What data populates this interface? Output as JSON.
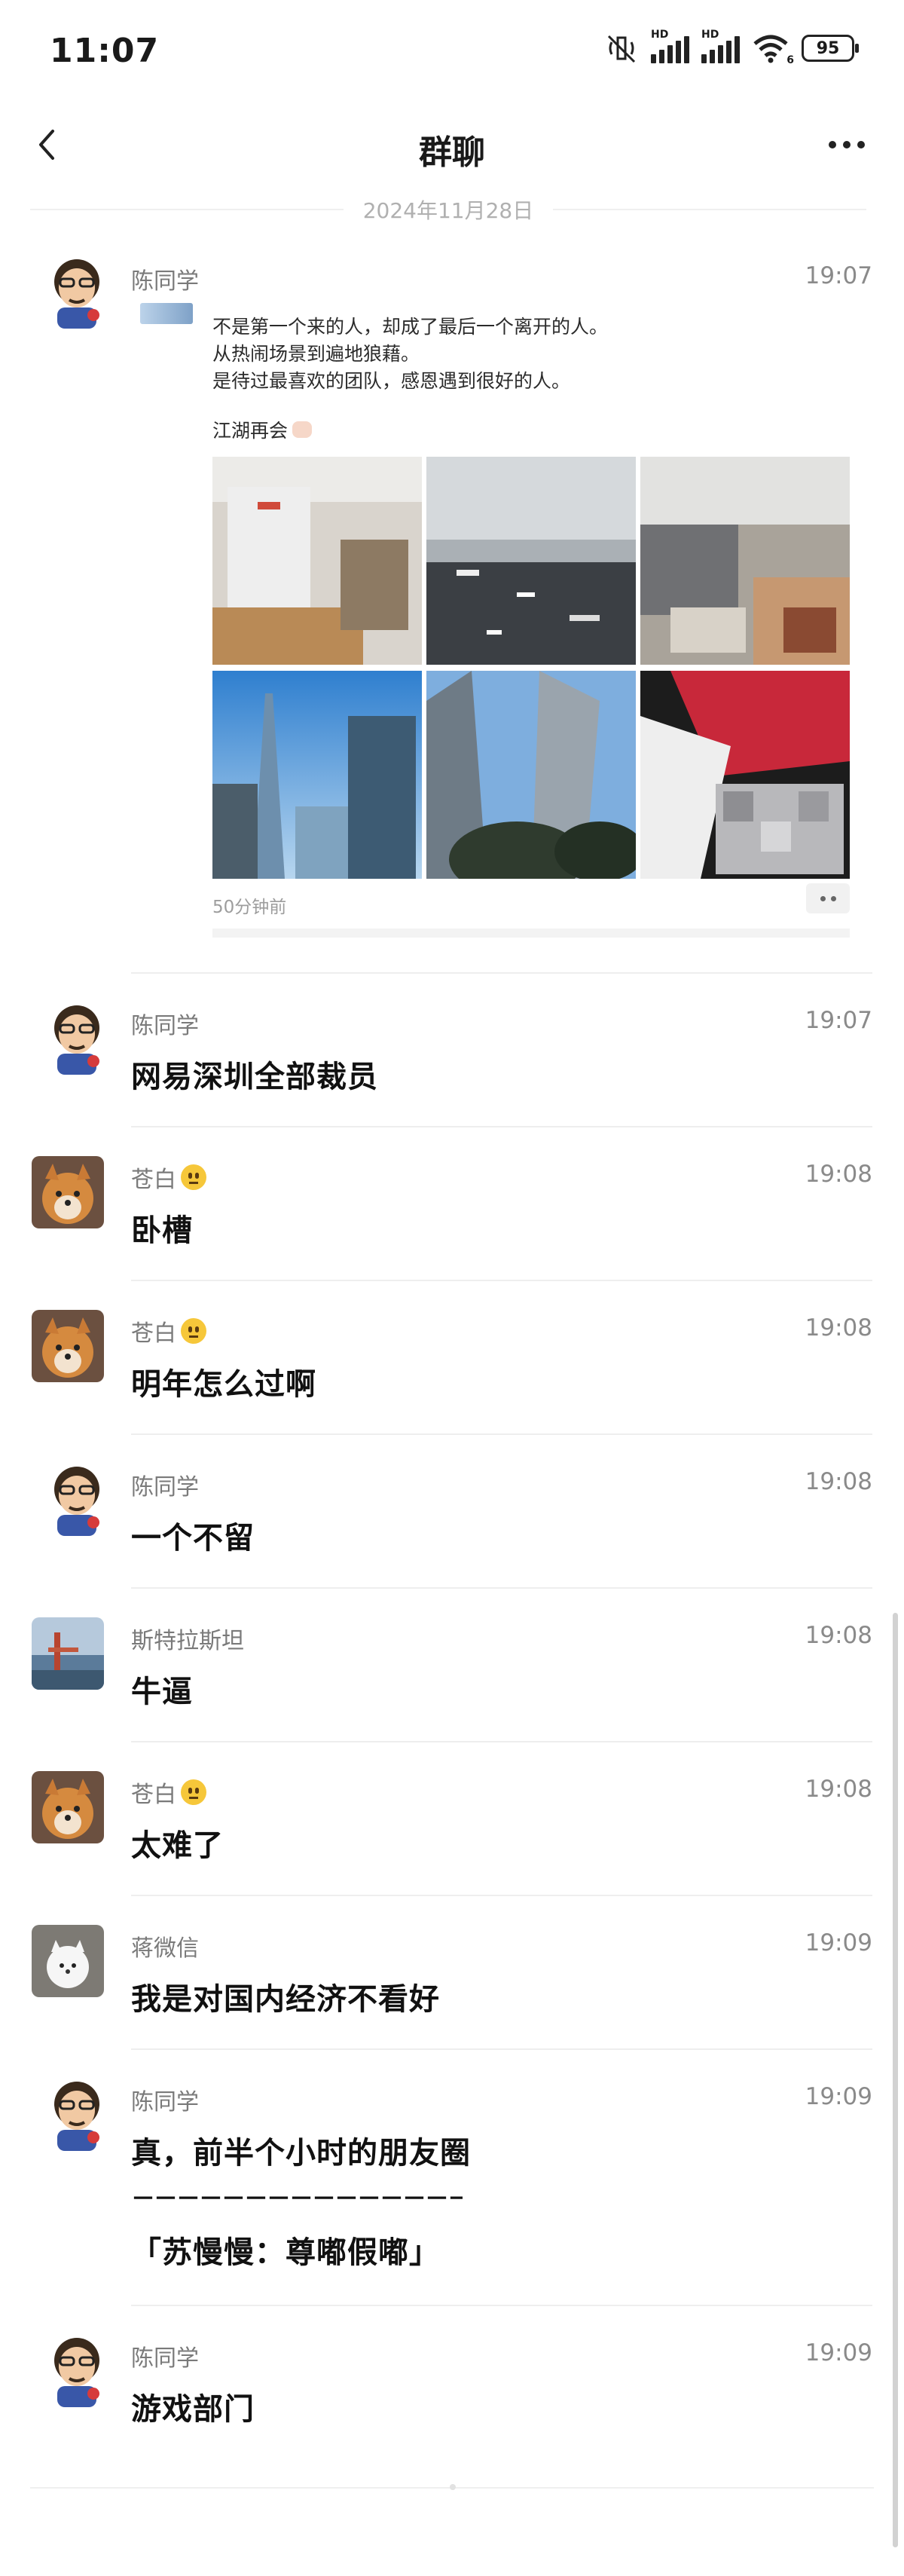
{
  "status_bar": {
    "time": "11:07",
    "signal_badges": [
      "HD",
      "HD"
    ],
    "wifi_badge": "6",
    "battery": "95"
  },
  "nav": {
    "title": "群聊"
  },
  "date_separator": "2024年11月28日",
  "messages": [
    {
      "sender": "陈同学",
      "time": "19:07",
      "type": "moments-card",
      "card": {
        "lines": [
          "不是第一个来的人，却成了最后一个离开的人。",
          "从热闹场景到遍地狼藉。",
          "是待过最喜欢的团队，感恩遇到很好的人。",
          "江湖再会"
        ],
        "time_ago": "50分钟前",
        "photos": [
          "empty-office-photo",
          "messy-office-floor-photo",
          "office-boxes-photo",
          "shenzhen-skyline-photo",
          "tower-building-photo",
          "red-black-blurred-photo"
        ]
      }
    },
    {
      "sender": "陈同学",
      "time": "19:07",
      "text": "网易深圳全部裁员"
    },
    {
      "sender": "苍白",
      "time": "19:08",
      "text": "卧槽"
    },
    {
      "sender": "苍白",
      "time": "19:08",
      "text": "明年怎么过啊"
    },
    {
      "sender": "陈同学",
      "time": "19:08",
      "text": "一个不留"
    },
    {
      "sender": "斯特拉斯坦",
      "time": "19:08",
      "text": "牛逼"
    },
    {
      "sender": "苍白",
      "time": "19:08",
      "text": "太难了"
    },
    {
      "sender": "蒋微信",
      "time": "19:09",
      "text": "我是对国内经济不看好"
    },
    {
      "sender": "陈同学",
      "time": "19:09",
      "text_lines": [
        "真，前半个小时的朋友圈",
        "－－－－－－－－－－－－－－－",
        "「苏慢慢：尊嘟假嘟」"
      ]
    },
    {
      "sender": "陈同学",
      "time": "19:09",
      "text": "游戏部门"
    }
  ]
}
